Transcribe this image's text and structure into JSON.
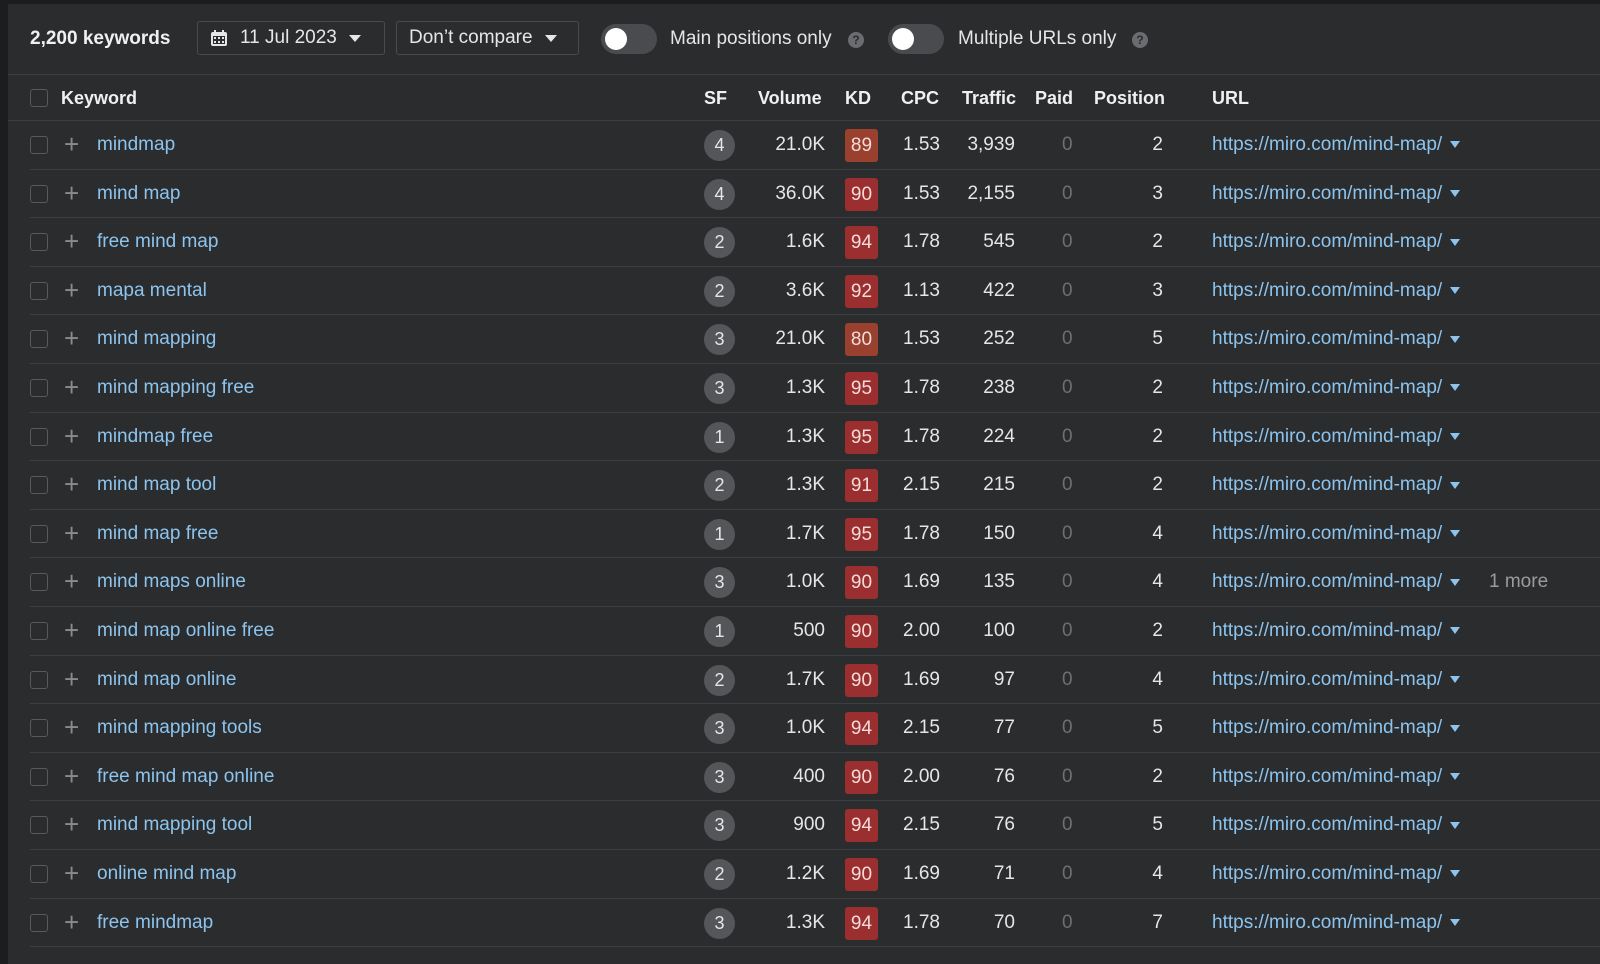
{
  "toolbar": {
    "keyword_count": "2,200 keywords",
    "date": "11 Jul 2023",
    "compare": "Don’t compare",
    "toggle_main_positions": "Main positions only",
    "toggle_multiple_urls": "Multiple URLs only",
    "help": "?"
  },
  "columns": {
    "keyword": "Keyword",
    "sf": "SF",
    "volume": "Volume",
    "kd": "KD",
    "cpc": "CPC",
    "traffic": "Traffic",
    "paid": "Paid",
    "position": "Position",
    "url": "URL"
  },
  "colors": {
    "kd_red": "#9b2f30",
    "kd_orange": "#99402f",
    "link": "#8cc4ee",
    "background": "#2b2c2e"
  },
  "rows": [
    {
      "keyword": "mindmap",
      "sf": "4",
      "volume": "21.0K",
      "kd": "89",
      "kd_orange": true,
      "cpc": "1.53",
      "traffic": "3,939",
      "paid": "0",
      "position": "2",
      "url": "https://miro.com/mind-map/"
    },
    {
      "keyword": "mind map",
      "sf": "4",
      "volume": "36.0K",
      "kd": "90",
      "cpc": "1.53",
      "traffic": "2,155",
      "paid": "0",
      "position": "3",
      "url": "https://miro.com/mind-map/"
    },
    {
      "keyword": "free mind map",
      "sf": "2",
      "volume": "1.6K",
      "kd": "94",
      "cpc": "1.78",
      "traffic": "545",
      "paid": "0",
      "position": "2",
      "url": "https://miro.com/mind-map/"
    },
    {
      "keyword": "mapa mental",
      "sf": "2",
      "volume": "3.6K",
      "kd": "92",
      "cpc": "1.13",
      "traffic": "422",
      "paid": "0",
      "position": "3",
      "url": "https://miro.com/mind-map/"
    },
    {
      "keyword": "mind mapping",
      "sf": "3",
      "volume": "21.0K",
      "kd": "80",
      "kd_orange": true,
      "cpc": "1.53",
      "traffic": "252",
      "paid": "0",
      "position": "5",
      "url": "https://miro.com/mind-map/"
    },
    {
      "keyword": "mind mapping free",
      "sf": "3",
      "volume": "1.3K",
      "kd": "95",
      "cpc": "1.78",
      "traffic": "238",
      "paid": "0",
      "position": "2",
      "url": "https://miro.com/mind-map/"
    },
    {
      "keyword": "mindmap free",
      "sf": "1",
      "volume": "1.3K",
      "kd": "95",
      "cpc": "1.78",
      "traffic": "224",
      "paid": "0",
      "position": "2",
      "url": "https://miro.com/mind-map/"
    },
    {
      "keyword": "mind map tool",
      "sf": "2",
      "volume": "1.3K",
      "kd": "91",
      "cpc": "2.15",
      "traffic": "215",
      "paid": "0",
      "position": "2",
      "url": "https://miro.com/mind-map/"
    },
    {
      "keyword": "mind map free",
      "sf": "1",
      "volume": "1.7K",
      "kd": "95",
      "cpc": "1.78",
      "traffic": "150",
      "paid": "0",
      "position": "4",
      "url": "https://miro.com/mind-map/"
    },
    {
      "keyword": "mind maps online",
      "sf": "3",
      "volume": "1.0K",
      "kd": "90",
      "cpc": "1.69",
      "traffic": "135",
      "paid": "0",
      "position": "4",
      "url": "https://miro.com/mind-map/",
      "more": "1 more"
    },
    {
      "keyword": "mind map online free",
      "sf": "1",
      "volume": "500",
      "kd": "90",
      "cpc": "2.00",
      "traffic": "100",
      "paid": "0",
      "position": "2",
      "url": "https://miro.com/mind-map/"
    },
    {
      "keyword": "mind map online",
      "sf": "2",
      "volume": "1.7K",
      "kd": "90",
      "cpc": "1.69",
      "traffic": "97",
      "paid": "0",
      "position": "4",
      "url": "https://miro.com/mind-map/"
    },
    {
      "keyword": "mind mapping tools",
      "sf": "3",
      "volume": "1.0K",
      "kd": "94",
      "cpc": "2.15",
      "traffic": "77",
      "paid": "0",
      "position": "5",
      "url": "https://miro.com/mind-map/"
    },
    {
      "keyword": "free mind map online",
      "sf": "3",
      "volume": "400",
      "kd": "90",
      "cpc": "2.00",
      "traffic": "76",
      "paid": "0",
      "position": "2",
      "url": "https://miro.com/mind-map/"
    },
    {
      "keyword": "mind mapping tool",
      "sf": "3",
      "volume": "900",
      "kd": "94",
      "cpc": "2.15",
      "traffic": "76",
      "paid": "0",
      "position": "5",
      "url": "https://miro.com/mind-map/"
    },
    {
      "keyword": "online mind map",
      "sf": "2",
      "volume": "1.2K",
      "kd": "90",
      "cpc": "1.69",
      "traffic": "71",
      "paid": "0",
      "position": "4",
      "url": "https://miro.com/mind-map/"
    },
    {
      "keyword": "free mindmap",
      "sf": "3",
      "volume": "1.3K",
      "kd": "94",
      "cpc": "1.78",
      "traffic": "70",
      "paid": "0",
      "position": "7",
      "url": "https://miro.com/mind-map/"
    }
  ]
}
